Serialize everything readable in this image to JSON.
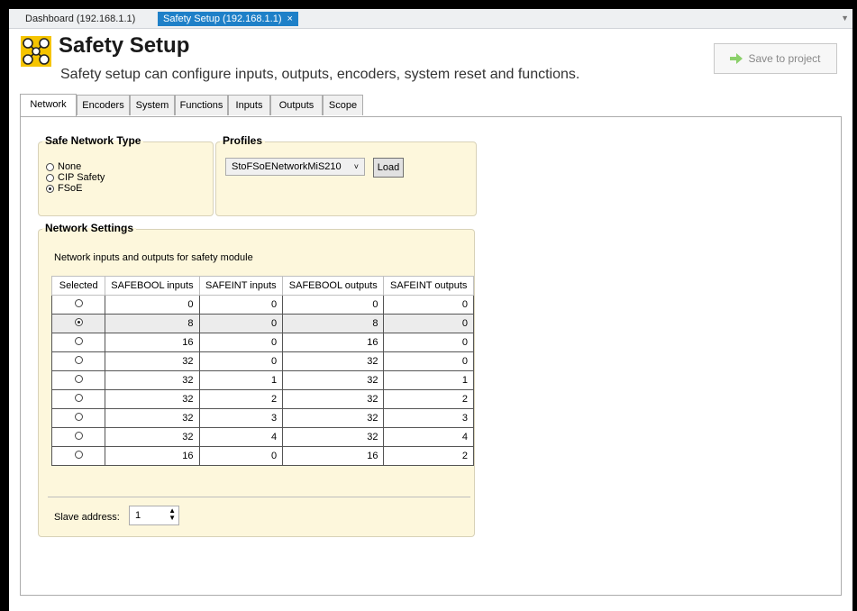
{
  "doc_tabs": [
    {
      "label": "Dashboard (192.168.1.1)"
    },
    {
      "label": "Safety Setup (192.168.1.1)",
      "close": "×"
    }
  ],
  "header": {
    "title": "Safety Setup",
    "subtitle": "Safety setup can configure inputs, outputs, encoders, system reset and functions.",
    "save_label": "Save to project",
    "accent_color": "#f5c400"
  },
  "tabs": [
    "Network",
    "Encoders",
    "System",
    "Functions",
    "Inputs",
    "Outputs",
    "Scope"
  ],
  "active_tab": "Network",
  "safe_network_type": {
    "title": "Safe Network Type",
    "options": [
      "None",
      "CIP Safety",
      "FSoE"
    ],
    "selected": "FSoE"
  },
  "profiles": {
    "title": "Profiles",
    "selected": "StoFSoENetworkMiS210",
    "load_label": "Load"
  },
  "network_settings": {
    "title": "Network Settings",
    "description": "Network inputs and outputs for safety module",
    "columns": [
      "Selected",
      "SAFEBOOL inputs",
      "SAFEINT inputs",
      "SAFEBOOL outputs",
      "SAFEINT outputs"
    ],
    "rows": [
      {
        "selected": false,
        "cells": [
          "0",
          "0",
          "0",
          "0"
        ]
      },
      {
        "selected": true,
        "cells": [
          "8",
          "0",
          "8",
          "0"
        ]
      },
      {
        "selected": false,
        "cells": [
          "16",
          "0",
          "16",
          "0"
        ]
      },
      {
        "selected": false,
        "cells": [
          "32",
          "0",
          "32",
          "0"
        ]
      },
      {
        "selected": false,
        "cells": [
          "32",
          "1",
          "32",
          "1"
        ]
      },
      {
        "selected": false,
        "cells": [
          "32",
          "2",
          "32",
          "2"
        ]
      },
      {
        "selected": false,
        "cells": [
          "32",
          "3",
          "32",
          "3"
        ]
      },
      {
        "selected": false,
        "cells": [
          "32",
          "4",
          "32",
          "4"
        ]
      },
      {
        "selected": false,
        "cells": [
          "16",
          "0",
          "16",
          "2"
        ]
      }
    ],
    "slave_label": "Slave address:",
    "slave_value": "1"
  }
}
